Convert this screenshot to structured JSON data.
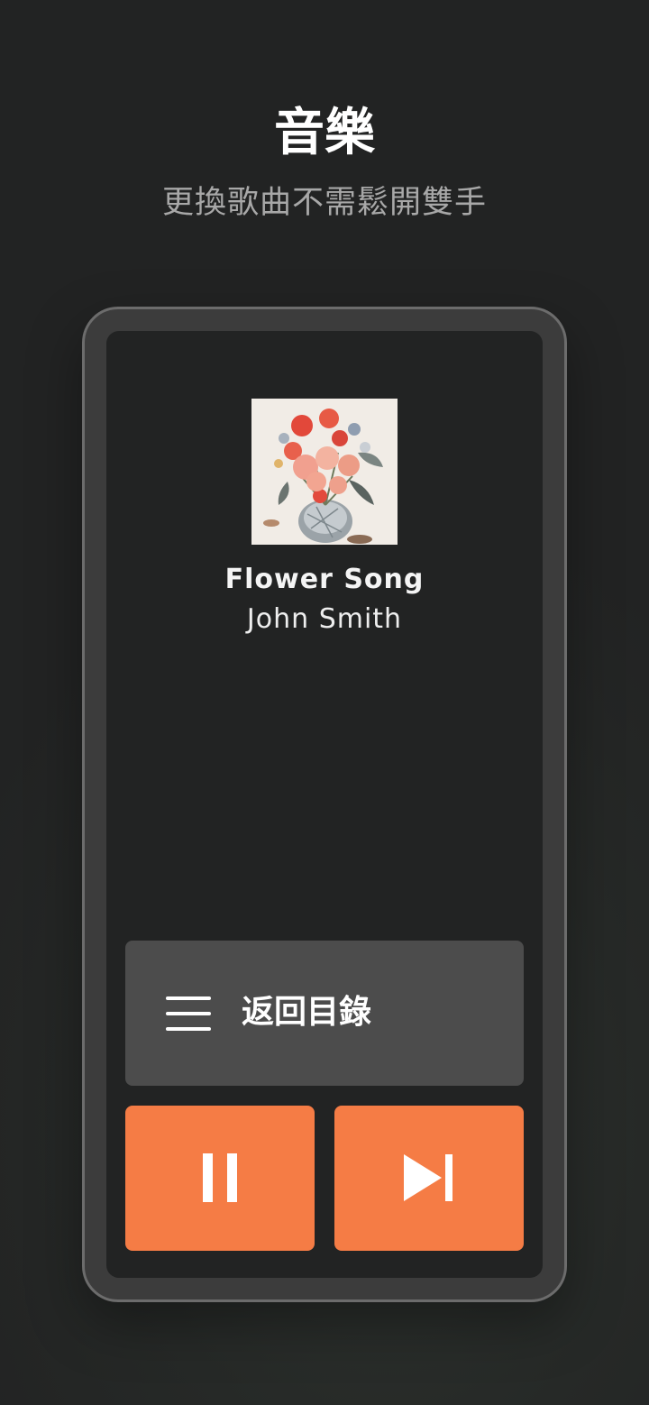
{
  "header": {
    "title": "音樂",
    "subtitle": "更換歌曲不需鬆開雙手"
  },
  "player": {
    "song_title": "Flower Song",
    "artist": "John Smith",
    "album_art_icon": "flower-bouquet-painting"
  },
  "controls": {
    "back_label": "返回目錄",
    "back_icon": "menu-icon",
    "pause_icon": "pause-icon",
    "next_icon": "skip-next-icon"
  },
  "colors": {
    "background": "#222323",
    "accent": "#f57c45",
    "panel": "#4c4c4c",
    "subtitle_text": "#a8a8a8"
  }
}
